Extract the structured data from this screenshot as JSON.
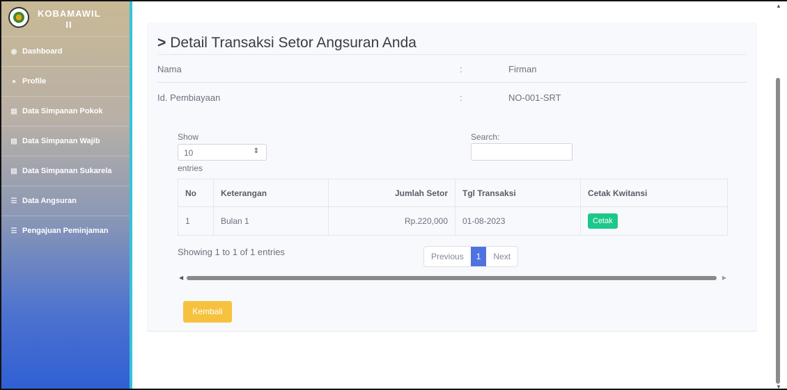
{
  "sidebar": {
    "brand": "KOBAMAWIL II",
    "items": [
      {
        "label": "Dashboard",
        "icon": "tachometer-icon"
      },
      {
        "label": "Profile",
        "icon": "user-icon"
      },
      {
        "label": "Data Simpanan Pokok",
        "icon": "document-icon"
      },
      {
        "label": "Data Simpanan Wajib",
        "icon": "document-icon"
      },
      {
        "label": "Data Simpanan Sukarela",
        "icon": "document-icon"
      },
      {
        "label": "Data Angsuran",
        "icon": "list-icon"
      },
      {
        "label": "Pengajuan Peminjaman",
        "icon": "list-icon"
      }
    ]
  },
  "page": {
    "title": "Detail Transaksi Setor Angsuran Anda",
    "info": [
      {
        "label": "Nama",
        "colon": ":",
        "value": "Firman"
      },
      {
        "label": "Id. Pembiayaan",
        "colon": ":",
        "value": "NO-001-SRT"
      }
    ]
  },
  "datatable": {
    "show_label": "Show",
    "show_value": "10",
    "entries_label": "entries",
    "search_label": "Search:",
    "search_value": "",
    "columns": [
      "No",
      "Keterangan",
      "Jumlah Setor",
      "Tgl Transaksi",
      "Cetak Kwitansi"
    ],
    "rows": [
      {
        "no": "1",
        "keterangan": "Bulan 1",
        "jumlah": "Rp.220,000",
        "tgl": "01-08-2023",
        "action": "Cetak"
      }
    ],
    "info": "Showing 1 to 1 of 1 entries",
    "pagination": {
      "previous": "Previous",
      "current": "1",
      "next": "Next"
    }
  },
  "back_button": "Kembali",
  "colors": {
    "primary": "#4e73df",
    "success": "#1cc88a",
    "warning": "#f6c23e",
    "sidebar_border": "#36c3d8"
  }
}
